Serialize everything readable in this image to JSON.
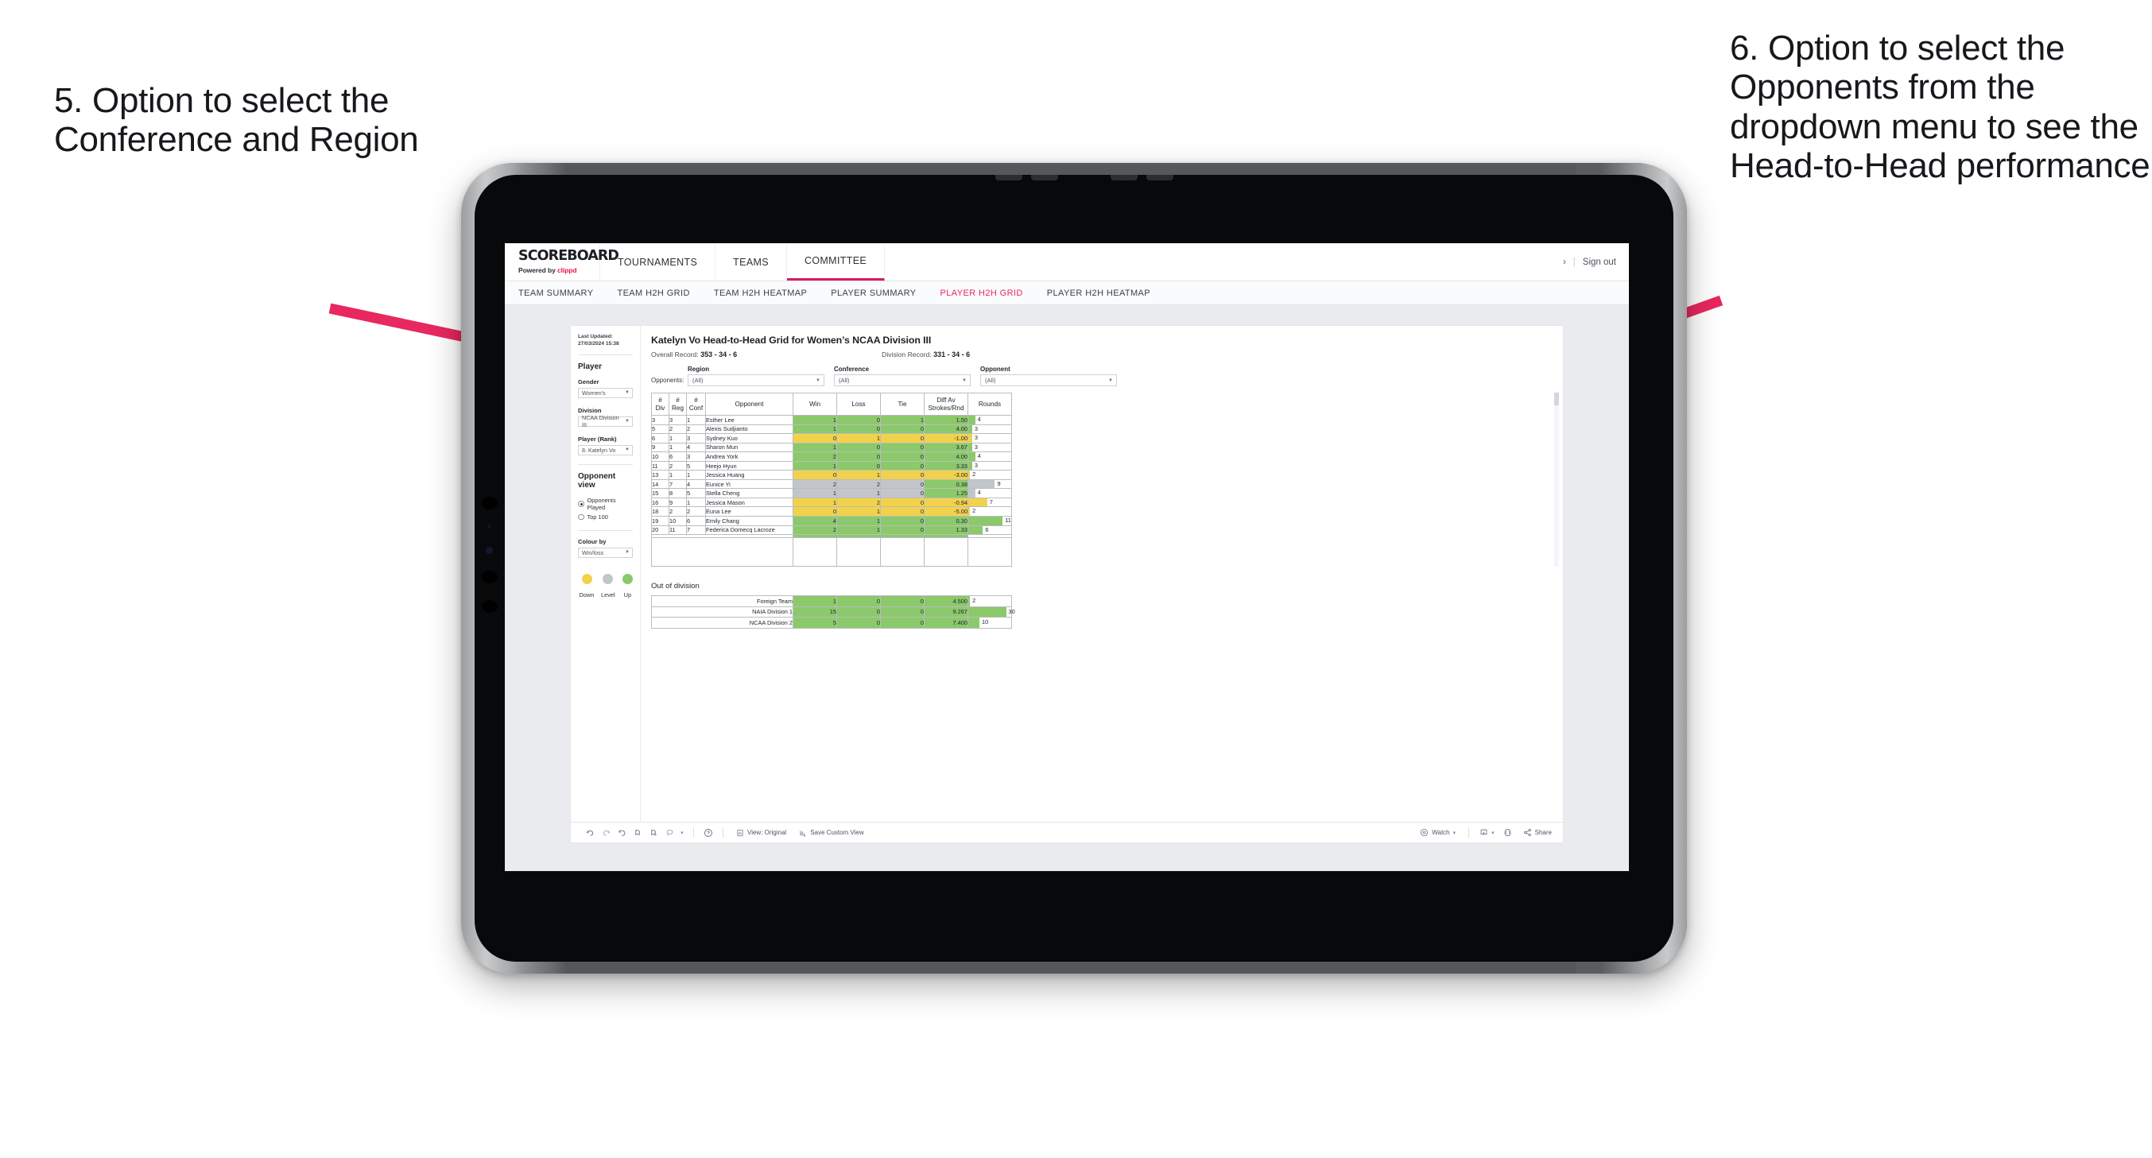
{
  "annotations": {
    "left": "5. Option to select the Conference and Region",
    "right": "6. Option to select the Opponents from the dropdown menu to see the Head-to-Head performance",
    "arrow_color": "#e8285f"
  },
  "app": {
    "brand": {
      "word": "SCOREBOARD",
      "powered_prefix": "Powered by ",
      "powered_brand": "clippd"
    },
    "nav": [
      {
        "label": "TOURNAMENTS",
        "active": false
      },
      {
        "label": "TEAMS",
        "active": false
      },
      {
        "label": "COMMITTEE",
        "active": true
      }
    ],
    "account": {
      "chevron": "›",
      "separator": "|",
      "signout": "Sign out"
    },
    "subnav": [
      {
        "label": "TEAM SUMMARY",
        "active": false
      },
      {
        "label": "TEAM H2H GRID",
        "active": false
      },
      {
        "label": "TEAM H2H HEATMAP",
        "active": false
      },
      {
        "label": "PLAYER SUMMARY",
        "active": false
      },
      {
        "label": "PLAYER H2H GRID",
        "active": true
      },
      {
        "label": "PLAYER H2H HEATMAP",
        "active": false
      }
    ]
  },
  "sidebar": {
    "last_updated": "Last Updated: 27/03/2024 15:38",
    "player_heading": "Player",
    "gender": {
      "label": "Gender",
      "value": "Women's"
    },
    "division": {
      "label": "Division",
      "value": "NCAA Division III"
    },
    "player_rank": {
      "label": "Player (Rank)",
      "value": "8. Katelyn Vo"
    },
    "opponent_view": {
      "heading": "Opponent view",
      "options": [
        {
          "label": "Opponents Played",
          "selected": true
        },
        {
          "label": "Top 100",
          "selected": false
        }
      ]
    },
    "colour_by": {
      "label": "Colour by",
      "value": "Win/loss"
    },
    "legend": [
      {
        "label": "Down",
        "color": "#f2d24b"
      },
      {
        "label": "Level",
        "color": "#c2c6ca"
      },
      {
        "label": "Up",
        "color": "#8bc96a"
      }
    ]
  },
  "viz": {
    "title": "Katelyn Vo Head-to-Head Grid for Women’s NCAA Division III",
    "overall_record_label": "Overall Record:",
    "overall_record_value": "353 -  34 - 6",
    "division_record_label": "Division Record:",
    "division_record_value": "331 -  34 - 6",
    "filters_label": "Opponents:",
    "filters": [
      {
        "label": "Region",
        "value": "(All)"
      },
      {
        "label": "Conference",
        "value": "(All)"
      },
      {
        "label": "Opponent",
        "value": "(All)"
      }
    ],
    "columns": [
      "# Div",
      "# Reg",
      "# Conf",
      "Opponent",
      "Win",
      "Loss",
      "Tie",
      "Diff Av Strokes/Rnd",
      "Rounds"
    ],
    "columns_two_line": [
      {
        "top": "#",
        "bottom": "Div"
      },
      {
        "top": "#",
        "bottom": "Reg"
      },
      {
        "top": "#",
        "bottom": "Conf"
      },
      {
        "top": "",
        "bottom": "Opponent"
      },
      {
        "top": "",
        "bottom": "Win"
      },
      {
        "top": "",
        "bottom": "Loss"
      },
      {
        "top": "",
        "bottom": "Tie"
      },
      {
        "top": "Diff Av",
        "bottom": "Strokes/Rnd"
      },
      {
        "top": "",
        "bottom": "Rounds"
      }
    ],
    "rows": [
      {
        "div": "3",
        "reg": "3",
        "conf": "1",
        "opponent": "Esther Lee",
        "win": "1",
        "loss": "0",
        "tie": "1",
        "diff": "1.50",
        "rounds": "4",
        "color": "#8bc96a",
        "rounds_pct": 16
      },
      {
        "div": "5",
        "reg": "2",
        "conf": "2",
        "opponent": "Alexis Sudjianto",
        "win": "1",
        "loss": "0",
        "tie": "0",
        "diff": "4.00",
        "rounds": "3",
        "color": "#8bc96a",
        "rounds_pct": 9
      },
      {
        "div": "6",
        "reg": "1",
        "conf": "3",
        "opponent": "Sydney Kuo",
        "win": "0",
        "loss": "1",
        "tie": "0",
        "diff": "-1.00",
        "rounds": "3",
        "color": "#f2d24b",
        "rounds_pct": 9
      },
      {
        "div": "9",
        "reg": "1",
        "conf": "4",
        "opponent": "Sharon Mun",
        "win": "1",
        "loss": "0",
        "tie": "0",
        "diff": "3.67",
        "rounds": "3",
        "color": "#8bc96a",
        "rounds_pct": 9
      },
      {
        "div": "10",
        "reg": "6",
        "conf": "3",
        "opponent": "Andrea York",
        "win": "2",
        "loss": "0",
        "tie": "0",
        "diff": "4.00",
        "rounds": "4",
        "color": "#8bc96a",
        "rounds_pct": 16
      },
      {
        "div": "11",
        "reg": "2",
        "conf": "5",
        "opponent": "Heejo Hyun",
        "win": "1",
        "loss": "0",
        "tie": "0",
        "diff": "3.33",
        "rounds": "3",
        "color": "#8bc96a",
        "rounds_pct": 9
      },
      {
        "div": "13",
        "reg": "1",
        "conf": "1",
        "opponent": "Jessica Huang",
        "win": "0",
        "loss": "1",
        "tie": "0",
        "diff": "-3.00",
        "rounds": "2",
        "color": "#f2d24b",
        "rounds_pct": 4
      },
      {
        "div": "14",
        "reg": "7",
        "conf": "4",
        "opponent": "Eunice Yi",
        "win": "2",
        "loss": "2",
        "tie": "0",
        "diff": "0.38",
        "rounds": "9",
        "color": "#c2c6ca",
        "diff_color": "#8bc96a",
        "rounds_pct": 62
      },
      {
        "div": "15",
        "reg": "8",
        "conf": "5",
        "opponent": "Stella Cheng",
        "win": "1",
        "loss": "1",
        "tie": "0",
        "diff": "1.25",
        "rounds": "4",
        "color": "#c2c6ca",
        "diff_color": "#8bc96a",
        "rounds_pct": 16
      },
      {
        "div": "16",
        "reg": "9",
        "conf": "1",
        "opponent": "Jessica Mason",
        "win": "1",
        "loss": "2",
        "tie": "0",
        "diff": "-0.94",
        "rounds": "7",
        "color": "#f2d24b",
        "rounds_pct": 44
      },
      {
        "div": "18",
        "reg": "2",
        "conf": "2",
        "opponent": "Euna Lee",
        "win": "0",
        "loss": "1",
        "tie": "0",
        "diff": "-5.00",
        "rounds": "2",
        "color": "#f2d24b",
        "rounds_pct": 4
      },
      {
        "div": "19",
        "reg": "10",
        "conf": "6",
        "opponent": "Emily Chang",
        "win": "4",
        "loss": "1",
        "tie": "0",
        "diff": "0.30",
        "rounds": "11",
        "color": "#8bc96a",
        "rounds_pct": 80
      },
      {
        "div": "20",
        "reg": "11",
        "conf": "7",
        "opponent": "Federica Domecq Lacroze",
        "win": "2",
        "loss": "1",
        "tie": "0",
        "diff": "1.33",
        "rounds": "6",
        "color": "#8bc96a",
        "rounds_pct": 34
      }
    ],
    "out_of_division": {
      "heading": "Out of division",
      "rows": [
        {
          "name": "Foreign Team",
          "win": "1",
          "loss": "0",
          "tie": "0",
          "diff": "4.500",
          "rounds": "2",
          "color": "#8bc96a",
          "rounds_pct": 4
        },
        {
          "name": "NAIA Division 1",
          "win": "15",
          "loss": "0",
          "tie": "0",
          "diff": "9.267",
          "rounds": "30",
          "color": "#8bc96a",
          "rounds_pct": 88
        },
        {
          "name": "NCAA Division 2",
          "win": "5",
          "loss": "0",
          "tie": "0",
          "diff": "7.400",
          "rounds": "10",
          "color": "#8bc96a",
          "rounds_pct": 26
        }
      ]
    }
  },
  "toolbar": {
    "icons": [
      "undo-icon",
      "redo-icon",
      "revert-icon",
      "refresh-icon",
      "pause-icon",
      "lasso-icon",
      "lasso-caret-icon"
    ],
    "help_icon": "help-icon",
    "view_label": "View: Original",
    "save_label": "Save Custom View",
    "watch_label": "Watch",
    "download_icon": "download-icon",
    "fullscreen_icon": "fullscreen-icon",
    "share_label": "Share"
  }
}
